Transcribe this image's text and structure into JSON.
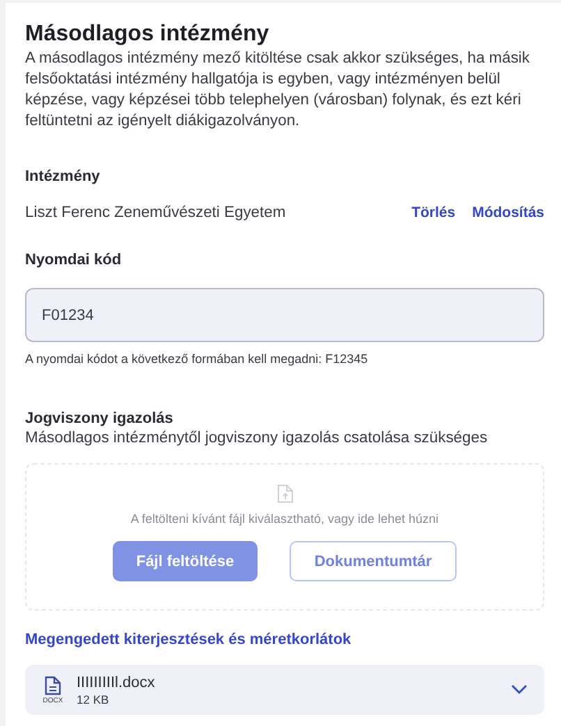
{
  "title": "Másodlagos intézmény",
  "description": "A másodlagos intézmény mező kitöltése csak akkor szükséges, ha másik felsőoktatási intézmény hallgatója is egyben, vagy intézményen belül képzése, vagy képzései több telephelyen (városban) folynak, és ezt kéri feltüntetni az igényelt diákigazolványon.",
  "institution": {
    "label": "Intézmény",
    "value": "Liszt Ferenc Zeneművészeti Egyetem",
    "actions": [
      "Törlés",
      "Módosítás"
    ]
  },
  "print_code": {
    "label": "Nyomdai kód",
    "value": "F01234",
    "hint": "A nyomdai kódot a következő formában kell megadni: F12345"
  },
  "certificate": {
    "label": "Jogviszony igazolás",
    "description": "Másodlagos intézménytől jogviszony igazolás csatolása szükséges",
    "upload": {
      "disabled": true,
      "text": "A feltölteni kívánt fájl kiválasztható, vagy ide lehet húzni",
      "buttons": [
        "Fájl feltöltése",
        "Dokumentumtár"
      ]
    },
    "limits_link": "Megengedett kiterjesztések és méretkorlátok",
    "files": [
      {
        "type": "DOCX",
        "name": "IIIIIIIIIl.docx",
        "size": "12 KB",
        "expanded": false
      }
    ]
  }
}
